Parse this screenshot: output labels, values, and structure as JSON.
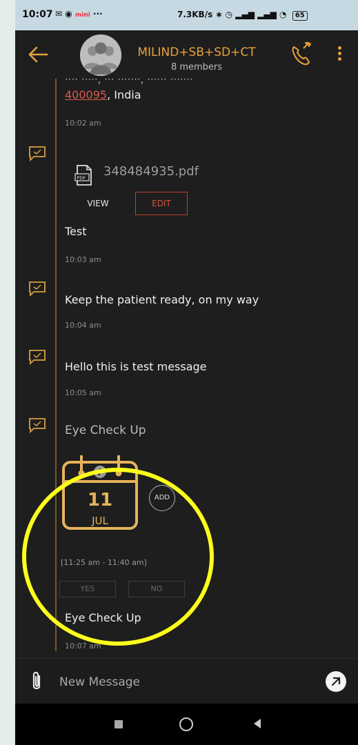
{
  "status_bar": {
    "time": "10:07",
    "network_speed": "7.3KB/s",
    "battery": "65"
  },
  "header": {
    "group_name": "MILIND+SB+SD+CT",
    "member_count": "8 members"
  },
  "messages": [
    {
      "address_zip": "400095",
      "address_rest": ", India",
      "time": "10:02 am"
    },
    {
      "file_name": "348484935.pdf",
      "view_label": "VIEW",
      "edit_label": "EDIT",
      "caption": "Test",
      "time": "10:03 am"
    },
    {
      "text": "Keep the patient ready, on my way",
      "time": "10:04 am"
    },
    {
      "text": "Hello this is test message",
      "time": "10:05 am"
    },
    {
      "event_title": "Eye Check Up",
      "day": "11",
      "month": "JUL",
      "add_label": "ADD",
      "time_range": "[11:25 am - 11:40 am]",
      "yes_label": "YES",
      "no_label": "NO",
      "caption": "Eye Check Up",
      "time": "10:07 am"
    }
  ],
  "composer": {
    "placeholder": "New Message"
  },
  "colors": {
    "accent": "#e9a23b",
    "highlight": "#ffff1c",
    "link": "#e05a4a",
    "background": "#1e1e1e"
  }
}
